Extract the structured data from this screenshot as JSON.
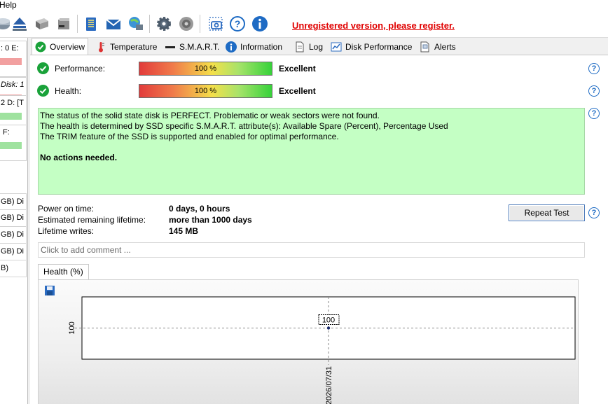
{
  "menu": {
    "help": "Help"
  },
  "toolbar": {
    "icons": [
      "disk-icon",
      "eject-icon",
      "hdd-icon",
      "drive-icon",
      "notepad-icon",
      "mail-icon",
      "network-icon",
      "gear-icon",
      "speaker-icon",
      "camera-icon",
      "help-icon",
      "info-icon"
    ],
    "register_text": "Unregistered version, please register."
  },
  "left_panel": {
    "devices": [
      {
        "label": ": 0  E:",
        "bar_color": "#f2a0a0"
      },
      {
        "label": "Disk: 1",
        "bar_color": "#f2a0a0"
      },
      {
        "label": "2  D: [T",
        "bar_color": "#9fe29f"
      },
      {
        "label": "F:",
        "bar_color": "#9fe29f"
      }
    ],
    "disks": [
      "GB)  Di",
      "GB)  Di",
      "GB)  Di",
      "GB)  Di",
      "B)"
    ]
  },
  "tabs": [
    {
      "label": "Overview",
      "icon": "check-icon"
    },
    {
      "label": "Temperature",
      "icon": "thermometer-icon"
    },
    {
      "label": "S.M.A.R.T.",
      "icon": "dash-icon"
    },
    {
      "label": "Information",
      "icon": "info-icon"
    },
    {
      "label": "Log",
      "icon": "document-icon"
    },
    {
      "label": "Disk Performance",
      "icon": "chart-icon"
    },
    {
      "label": "Alerts",
      "icon": "alert-icon"
    }
  ],
  "overview": {
    "performance": {
      "label": "Performance:",
      "value_text": "100 %",
      "percent": 100,
      "rating": "Excellent"
    },
    "health": {
      "label": "Health:",
      "value_text": "100 %",
      "percent": 100,
      "rating": "Excellent"
    },
    "status": {
      "line1": "The status of the solid state disk is PERFECT. Problematic or weak sectors were not found.",
      "line2": "The health is determined by SSD specific S.M.A.R.T. attribute(s):  Available Spare (Percent), Percentage Used",
      "line3": "The TRIM feature of the SSD is supported and enabled for optimal performance.",
      "action": "No actions needed."
    },
    "info": {
      "power_on_label": "Power on time:",
      "power_on_value": "0 days, 0 hours",
      "lifetime_label": "Estimated remaining lifetime:",
      "lifetime_value": "more than 1000 days",
      "writes_label": "Lifetime writes:",
      "writes_value": "145 MB"
    },
    "repeat_test": "Repeat Test",
    "comment_placeholder": "Click to add comment ..."
  },
  "chart_tab": "Health (%)",
  "chart_data": {
    "type": "line",
    "x": [
      "2026/07/31"
    ],
    "series": [
      {
        "values": [
          100
        ]
      }
    ],
    "data_labels": [
      "100"
    ],
    "ylabel_tick": "100",
    "xtick": "2026/07/31",
    "grid": true
  },
  "colors": {
    "status_bg": "#c4ffc4",
    "register": "#e00000",
    "check": "#1aa23a",
    "help": "#1e6bc4"
  }
}
